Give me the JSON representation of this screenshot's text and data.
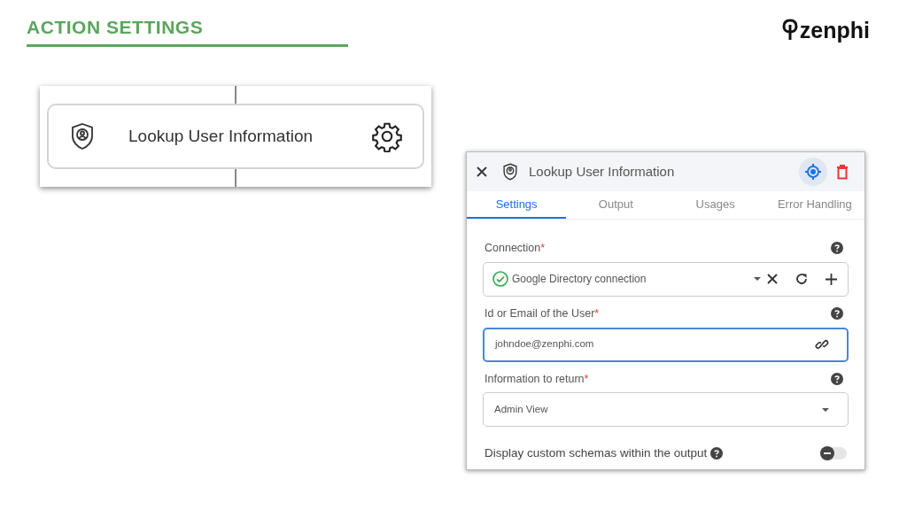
{
  "header": {
    "title": "ACTION SETTINGS"
  },
  "logo": {
    "text": "zenphi"
  },
  "node": {
    "label": "Lookup User Information"
  },
  "panel": {
    "title": "Lookup User Information",
    "tabs": [
      {
        "label": "Settings",
        "selected": true
      },
      {
        "label": "Output",
        "selected": false
      },
      {
        "label": "Usages",
        "selected": false
      },
      {
        "label": "Error Handling",
        "selected": false
      }
    ],
    "fields": [
      {
        "kind": "connection",
        "label": "Connection",
        "required_mark": "*",
        "value": "Google Directory connection",
        "focused": false
      },
      {
        "kind": "text",
        "label": "Id or Email of the User",
        "required_mark": "*",
        "value": "johndoe@zenphi.com",
        "focused": true
      },
      {
        "kind": "select",
        "label": "Information to return",
        "required_mark": "*",
        "value": "Admin View",
        "focused": false
      }
    ],
    "toggle": {
      "label": "Display custom schemas within the output",
      "on": false
    }
  }
}
